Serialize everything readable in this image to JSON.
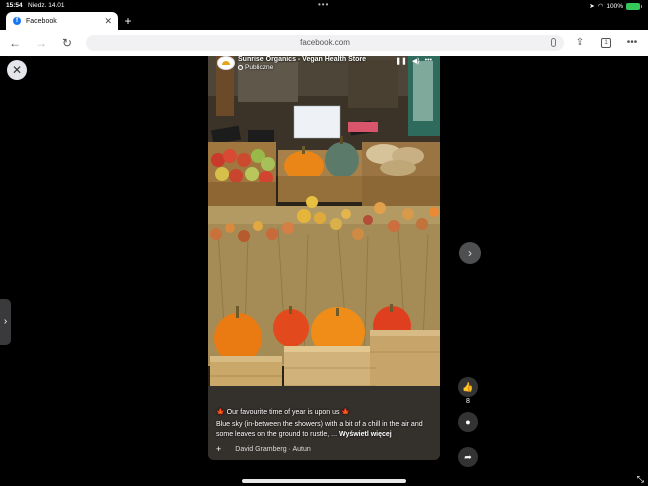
{
  "status_bar": {
    "time": "15:54",
    "date": "Niedz. 14.01",
    "battery": "100%"
  },
  "browser": {
    "tab": {
      "title": "Facebook",
      "icon": "facebook-f-icon"
    },
    "url": "facebook.com",
    "tab_count": "1"
  },
  "post": {
    "page_name": "Sunrise Organics - Vegan Health Store",
    "audience": "Publiczne",
    "caption_line1": "🍁 Our favourite time of year is upon us 🍁",
    "caption_body": "Blue sky (in-between the showers) with a bit of a chill in the air and some leaves on the ground to rustle, ...",
    "see_more": "Wyświetl więcej",
    "music": "David Gramberg · Autun",
    "like_count": "8"
  },
  "colors": {
    "facebook_blue": "#1877f2",
    "pumpkin_orange": "#ea7a12",
    "battery_green": "#35c759"
  }
}
